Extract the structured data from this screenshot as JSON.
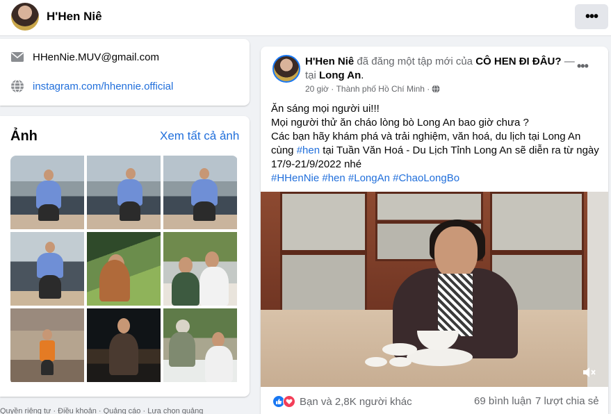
{
  "profile": {
    "name": "H'Hen Niê"
  },
  "topbar": {
    "more_label": "•••"
  },
  "intro": {
    "email": "HHenNie.MUV@gmail.com",
    "website": "instagram.com/hhennie.official"
  },
  "photos": {
    "title": "Ảnh",
    "see_all": "Xem tất cả ảnh",
    "count": 9
  },
  "footer": {
    "text": "Quyền riêng tư · Điều khoản · Quảng cáo · Lựa chọn quảng"
  },
  "post": {
    "author": "H'Hen Niê",
    "action": " đã đăng một tập mới của ",
    "show": "CÔ HEN ĐI ĐÂU?",
    "at_prefix": " — tại ",
    "location": "Long An",
    "time": "20 giờ",
    "place": "Thành phố Hồ Chí Minh",
    "line1": "Ăn sáng mọi người ui!!!",
    "line2": "Mọi người thử ăn cháo lòng bò Long An bao giờ chưa ?",
    "line3": "Các bạn hãy khám phá và trải nghiệm, văn hoá, du lịch tại Long An",
    "line4_a": "cùng ",
    "line4_tag": "#hen",
    "line4_b": " tại Tuần Văn Hoá - Du Lịch Tỉnh Long An sẽ diễn ra từ ngày",
    "line5": "17/9-21/9/2022 nhé",
    "hashtags": "#HHenNie #hen #LongAn #ChaoLongBo",
    "reactions_text": "Bạn và 2,8K người khác",
    "comments": "69 bình luận",
    "shares": "7 lượt chia sẻ"
  },
  "colors": {
    "link": "#216fdb",
    "like": "#1877f2",
    "love": "#f33e58"
  }
}
